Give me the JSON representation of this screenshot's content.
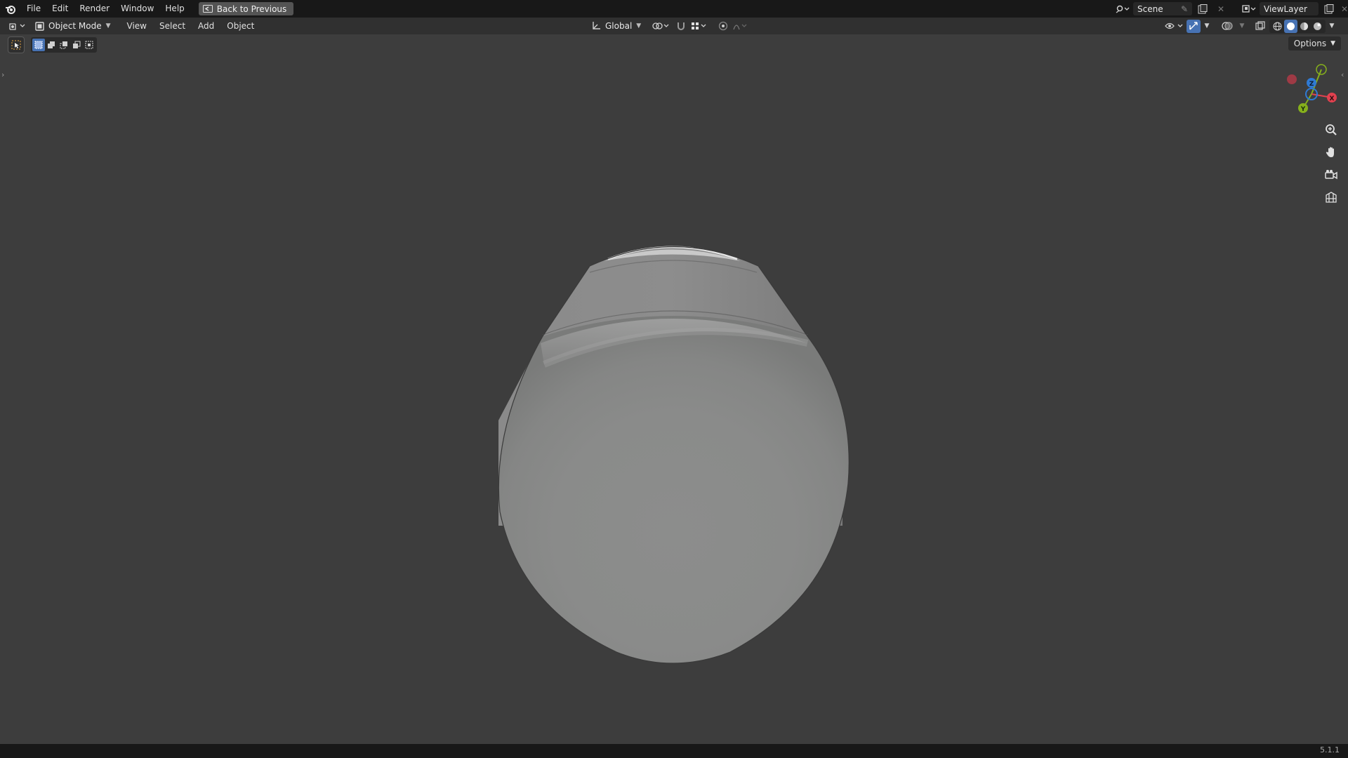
{
  "menubar": {
    "items": [
      "File",
      "Edit",
      "Render",
      "Window",
      "Help"
    ],
    "back_button": "Back to Previous",
    "scene": "Scene",
    "view_layer": "ViewLayer"
  },
  "header": {
    "mode": "Object Mode",
    "menus": [
      "View",
      "Select",
      "Add",
      "Object"
    ],
    "transform_orientation": "Global",
    "options": "Options"
  },
  "viewport": {
    "object": "cylinder mesh (bottom view, solid shading)",
    "gizmo_axes": [
      "Z",
      "X",
      "Y"
    ]
  },
  "status": {
    "version": "5.1.1"
  },
  "colors": {
    "accent": "#4772b3",
    "axis_x": "#e2414f",
    "axis_y": "#86b01c",
    "axis_z": "#2f7ad4",
    "viewport_bg": "#3d3d3d"
  }
}
